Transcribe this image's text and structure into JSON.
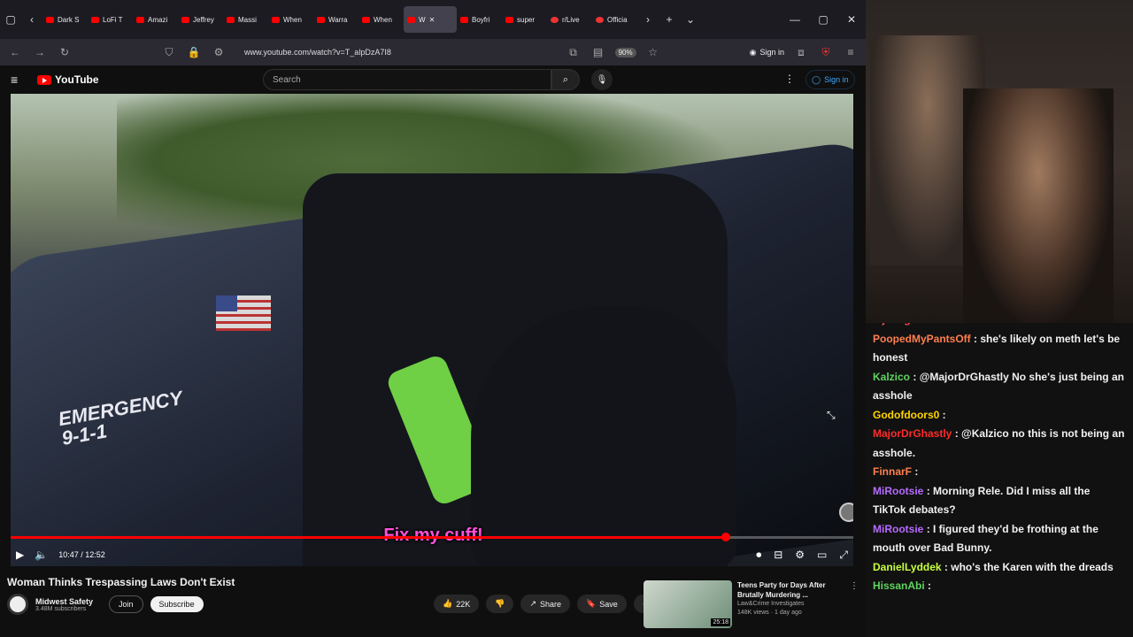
{
  "browser": {
    "tabs": [
      {
        "label": "Dark S",
        "kind": "yt"
      },
      {
        "label": "LoFi T",
        "kind": "yt"
      },
      {
        "label": "Amazi",
        "kind": "yt"
      },
      {
        "label": "Jeffrey",
        "kind": "yt"
      },
      {
        "label": "Massi",
        "kind": "yt"
      },
      {
        "label": "When",
        "kind": "yt"
      },
      {
        "label": "Warra",
        "kind": "yt"
      },
      {
        "label": "When",
        "kind": "yt"
      },
      {
        "label": "W",
        "kind": "yt",
        "active": true
      },
      {
        "label": "Boyfri",
        "kind": "yt"
      },
      {
        "label": "super",
        "kind": "yt"
      },
      {
        "label": "r/Live",
        "kind": "reddit"
      },
      {
        "label": "Officia",
        "kind": "reddit"
      }
    ],
    "url": "www.youtube.com/watch?v=T_alpDzA7I8",
    "zoom": "90%",
    "sign_in": "Sign in"
  },
  "youtube": {
    "logo": "YouTube",
    "search_placeholder": "Search",
    "sign_in": "Sign in"
  },
  "video": {
    "subtitle": "Fix my cuff!",
    "time": "10:47 / 12:52",
    "progress": 0.8484,
    "title": "Woman Thinks Trespassing Laws Don't Exist",
    "channel": "Midwest Safety",
    "subscribers": "3.48M subscribers",
    "join": "Join",
    "subscribe": "Subscribe",
    "likes": "22K",
    "share": "Share",
    "save": "Save"
  },
  "recommendation": {
    "title": "Teens Party for Days After Brutally Murdering ...",
    "channel": "Law&Crime Investigates",
    "meta": "148K views · 1 day ago",
    "duration": "25:18"
  },
  "chat": [
    {
      "user": "mjdang",
      "text": "",
      "color": "#ff4b4b"
    },
    {
      "user": "PoopedMyPantsOff",
      "text": ": she's likely on meth let's be honest",
      "color": "#ff7f50"
    },
    {
      "user": "Kalzico",
      "text": ": @MajorDrGhastly No she's just being an asshole",
      "color": "#5fd35f"
    },
    {
      "user": "Godofdoors0",
      "text": ":",
      "color": "#ffd400"
    },
    {
      "user": "MajorDrGhastly",
      "text": ": @Kalzico no this is not being an asshole.",
      "color": "#ff2b2b"
    },
    {
      "user": "FinnarF",
      "text": ":",
      "color": "#ff7f50"
    },
    {
      "user": "MiRootsie",
      "text": ": Morning Rele. Did I miss all the TikTok debates?",
      "color": "#b76bff"
    },
    {
      "user": "MiRootsie",
      "text": ": I figured they'd be frothing at the mouth over Bad Bunny.",
      "color": "#b76bff"
    },
    {
      "user": "DanielLyddek",
      "text": ": who's the Karen with the dreads",
      "color": "#c7ff3d"
    },
    {
      "user": "HissanAbi",
      "text": ":",
      "color": "#5fd35f"
    }
  ]
}
